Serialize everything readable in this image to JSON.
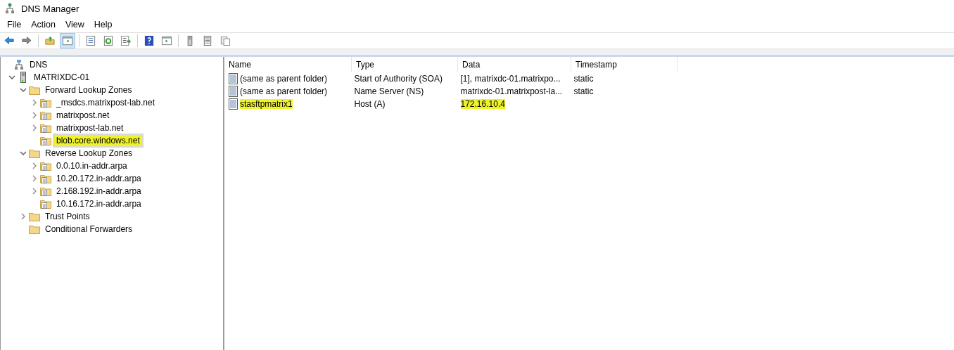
{
  "window": {
    "title": "DNS Manager"
  },
  "menu": [
    "File",
    "Action",
    "View",
    "Help"
  ],
  "toolbar": [
    {
      "kind": "back",
      "pressed": false
    },
    {
      "kind": "forward",
      "pressed": false
    },
    {
      "kind": "sep"
    },
    {
      "kind": "up",
      "pressed": false
    },
    {
      "kind": "tree",
      "pressed": true
    },
    {
      "kind": "sep"
    },
    {
      "kind": "props",
      "pressed": false
    },
    {
      "kind": "refresh",
      "pressed": false
    },
    {
      "kind": "export",
      "pressed": false
    },
    {
      "kind": "sep"
    },
    {
      "kind": "help",
      "pressed": false
    },
    {
      "kind": "pane",
      "pressed": false
    },
    {
      "kind": "sep"
    },
    {
      "kind": "server",
      "pressed": false
    },
    {
      "kind": "list",
      "pressed": false
    },
    {
      "kind": "copy",
      "pressed": false
    }
  ],
  "tree": [
    {
      "label": "DNS",
      "kind": "dns",
      "selected": false,
      "marked": false,
      "children": [
        {
          "label": "MATRIXDC-01",
          "kind": "server",
          "expanded": true,
          "selected": false,
          "marked": false,
          "children": [
            {
              "label": "Forward Lookup Zones",
              "kind": "folder",
              "expanded": true,
              "selected": false,
              "marked": false,
              "children": [
                {
                  "label": "_msdcs.matrixpost-lab.net",
                  "kind": "zone",
                  "expanded": false,
                  "selected": false,
                  "marked": false
                },
                {
                  "label": "matrixpost.net",
                  "kind": "zone",
                  "expanded": false,
                  "selected": false,
                  "marked": false
                },
                {
                  "label": "matrixpost-lab.net",
                  "kind": "zone",
                  "expanded": false,
                  "selected": false,
                  "marked": false
                },
                {
                  "label": "blob.core.windows.net",
                  "kind": "zone",
                  "selected": true,
                  "marked": true
                }
              ]
            },
            {
              "label": "Reverse Lookup Zones",
              "kind": "folder",
              "expanded": true,
              "selected": false,
              "marked": false,
              "children": [
                {
                  "label": "0.0.10.in-addr.arpa",
                  "kind": "zone",
                  "expanded": false,
                  "selected": false,
                  "marked": false
                },
                {
                  "label": "10.20.172.in-addr.arpa",
                  "kind": "zone",
                  "expanded": false,
                  "selected": false,
                  "marked": false
                },
                {
                  "label": "2.168.192.in-addr.arpa",
                  "kind": "zone",
                  "expanded": false,
                  "selected": false,
                  "marked": false
                },
                {
                  "label": "10.16.172.in-addr.arpa",
                  "kind": "zone",
                  "selected": false,
                  "marked": false
                }
              ]
            },
            {
              "label": "Trust Points",
              "kind": "folder",
              "expanded": false,
              "selected": false,
              "marked": false
            },
            {
              "label": "Conditional Forwarders",
              "kind": "folder",
              "selected": false,
              "marked": false
            }
          ]
        }
      ]
    }
  ],
  "table": {
    "columns": [
      "Name",
      "Type",
      "Data",
      "Timestamp"
    ],
    "rows": [
      {
        "cells": [
          "(same as parent folder)",
          "Start of Authority (SOA)",
          "[1], matrixdc-01.matrixpo...",
          "static"
        ],
        "marked": [
          false,
          false,
          false,
          false
        ]
      },
      {
        "cells": [
          "(same as parent folder)",
          "Name Server (NS)",
          "matrixdc-01.matrixpost-la...",
          "static"
        ],
        "marked": [
          false,
          false,
          false,
          false
        ]
      },
      {
        "cells": [
          "stasftpmatrix1",
          "Host (A)",
          "172.16.10.4"
        ],
        "marked": [
          true,
          false,
          true
        ]
      }
    ]
  }
}
